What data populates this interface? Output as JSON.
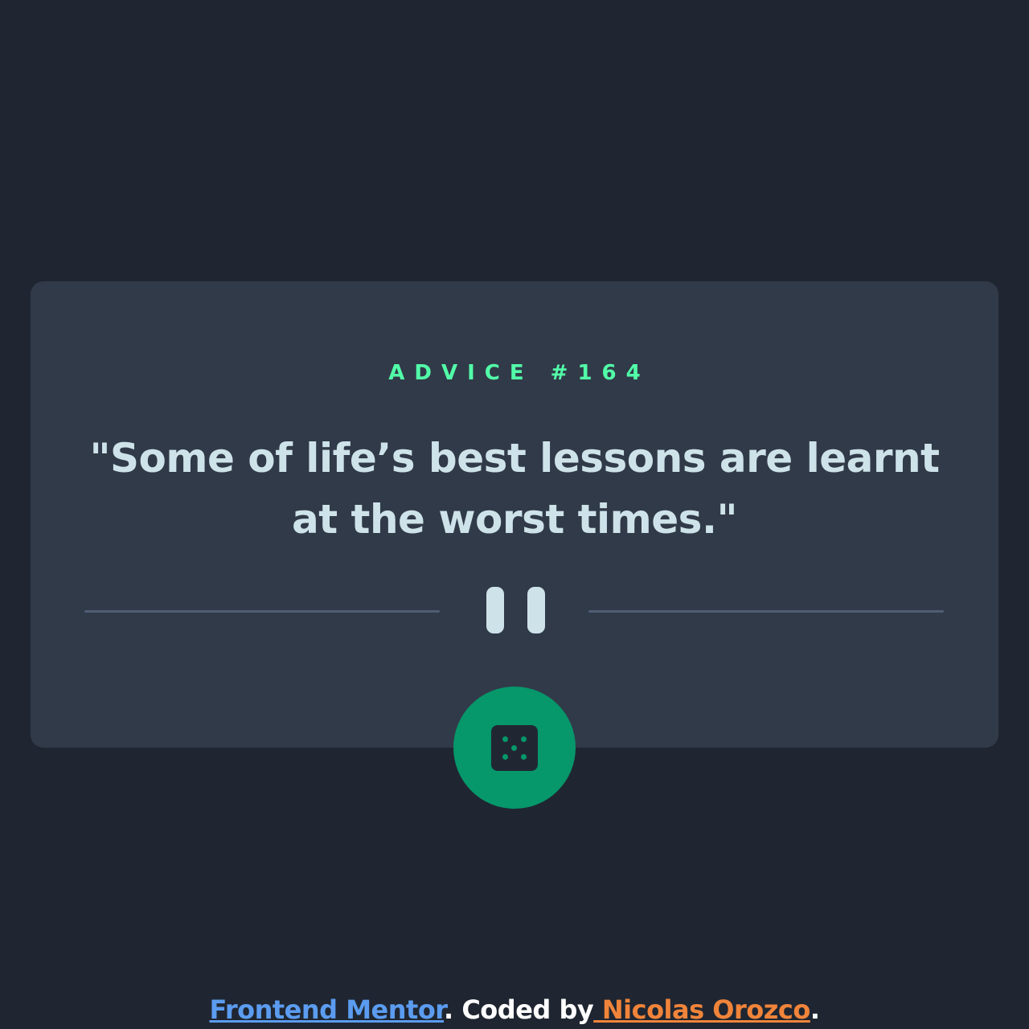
{
  "advice": {
    "id_label": "ADVICE #164",
    "quote": "\"Some of life’s best lessons are learnt at the worst times.\""
  },
  "divider": {
    "icon": "pause-icon"
  },
  "dice_button": {
    "icon": "dice-icon"
  },
  "footer": {
    "frontend_mentor_link": "Frontend Mentor",
    "separator_text": ". Coded by",
    "author_link": " Nicolas Orozco",
    "end_text": "."
  },
  "colors": {
    "background": "#1f2631",
    "card": "#313a49",
    "accent_green": "#52ffa8",
    "button_green": "#06976a",
    "quote_text": "#cee3e9",
    "link_blue": "#5b9cf0",
    "link_orange": "#f0843a"
  }
}
